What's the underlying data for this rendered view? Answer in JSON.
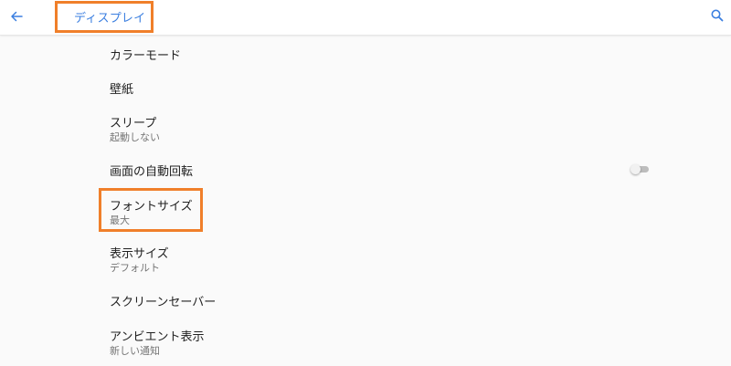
{
  "header": {
    "title": "ディスプレイ",
    "back_icon": "arrow-left-icon",
    "search_icon": "search-icon",
    "accent_color": "#3b7fe0",
    "highlight_color": "#f07f2a"
  },
  "settings": [
    {
      "title": "カラーモード"
    },
    {
      "title": "壁紙"
    },
    {
      "title": "スリープ",
      "summary": "起動しない"
    },
    {
      "title": "画面の自動回転",
      "toggle": false
    },
    {
      "title": "フォントサイズ",
      "summary": "最大"
    },
    {
      "title": "表示サイズ",
      "summary": "デフォルト"
    },
    {
      "title": "スクリーンセーバー"
    },
    {
      "title": "アンビエント表示",
      "summary": "新しい通知"
    }
  ]
}
